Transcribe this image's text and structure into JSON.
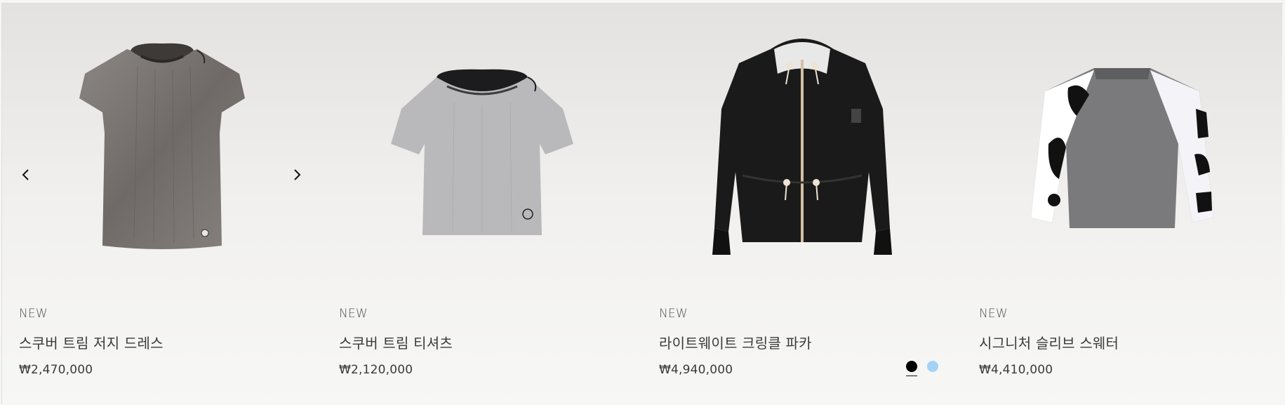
{
  "colors": {
    "swatch_black": "#000000",
    "swatch_light_blue": "#a4d2f5"
  },
  "carousel": {
    "prev_icon": "chevron-left-icon",
    "next_icon": "chevron-right-icon"
  },
  "products": [
    {
      "badge": "NEW",
      "name": "스쿠버 트림 저지 드레스",
      "price": "₩2,470,000",
      "image_icon": "gray-denim-dress"
    },
    {
      "badge": "NEW",
      "name": "스쿠버 트림 티셔츠",
      "price": "₩2,120,000",
      "image_icon": "light-gray-tshirt"
    },
    {
      "badge": "NEW",
      "name": "라이트웨이트 크링클 파카",
      "price": "₩4,940,000",
      "image_icon": "black-parka",
      "swatches": [
        {
          "color": "#000000",
          "selected": true
        },
        {
          "color": "#a4d2f5",
          "selected": false
        }
      ]
    },
    {
      "badge": "NEW",
      "name": "시그니처 슬리브 스웨터",
      "price": "₩4,410,000",
      "image_icon": "signature-sleeve-sweater"
    }
  ]
}
